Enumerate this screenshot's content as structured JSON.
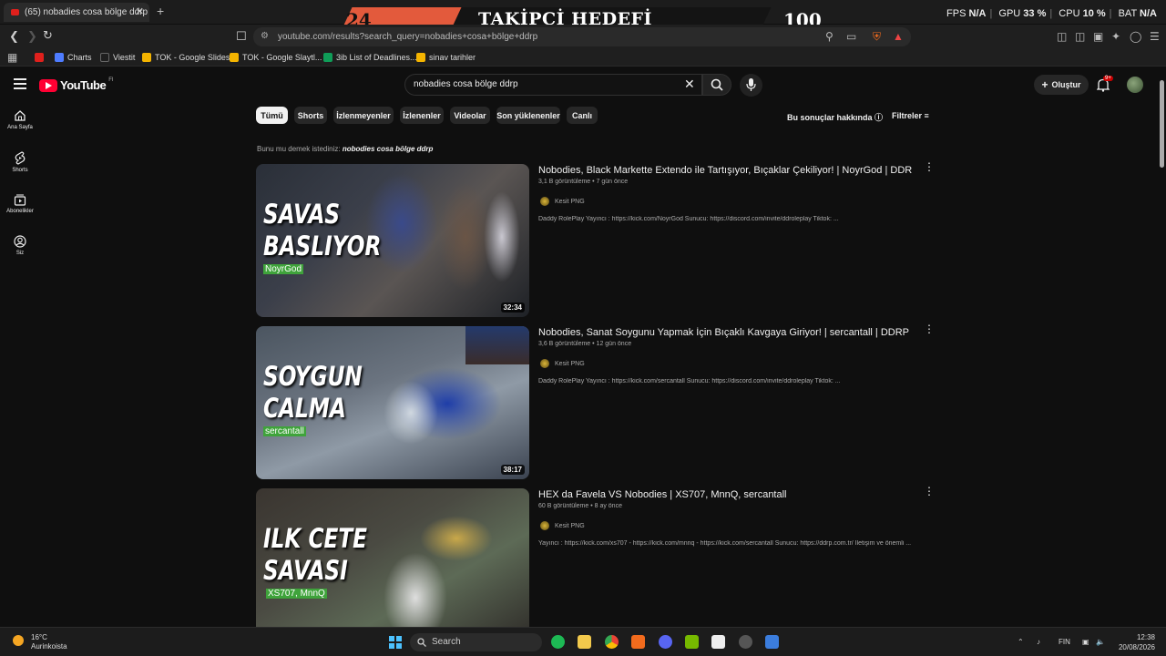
{
  "browser": {
    "tab_title": "(65) nobadies cosa bölge ddrp -",
    "tab_close": "✕",
    "new_tab": "+",
    "url": "youtube.com/results?search_query=nobadies+cosa+bölge+ddrp",
    "bookmarks": [
      {
        "label": "",
        "color": "#e0201c"
      },
      {
        "label": "Charts",
        "color": "#4e7cff"
      },
      {
        "label": "Viestit",
        "color": "#555555"
      },
      {
        "label": "TOK - Google Slides",
        "color": "#f4b400"
      },
      {
        "label": "TOK - Google Slaytl...",
        "color": "#f4b400"
      },
      {
        "label": "3ib List of Deadlines...",
        "color": "#0f9d58"
      },
      {
        "label": "sinav tarihler",
        "color": "#f4b400"
      }
    ]
  },
  "overlay": {
    "left_number": "24",
    "title": "TAKİPÇİ HEDEFİ",
    "right_number": "100"
  },
  "system_stats": {
    "fps_label": "FPS",
    "fps_value": "N/A",
    "gpu_label": "GPU",
    "gpu_value": "33 %",
    "cpu_label": "CPU",
    "cpu_value": "10 %",
    "bat_label": "BAT",
    "bat_value": "N/A"
  },
  "youtube": {
    "logo_text": "YouTube",
    "logo_country": "FI",
    "search_query": "nobadies cosa bölge ddrp",
    "create_label": "Oluştur",
    "notification_count": "9+",
    "sidebar": [
      {
        "label": "Ana Sayfa",
        "icon": "home-icon"
      },
      {
        "label": "Shorts",
        "icon": "shorts-icon"
      },
      {
        "label": "Abonelikler",
        "icon": "subscriptions-icon"
      },
      {
        "label": "Siz",
        "icon": "you-icon"
      }
    ],
    "chips": [
      "Tümü",
      "Shorts",
      "İzlenmeyenler",
      "İzlenenler",
      "Videolar",
      "Son yüklenenler",
      "Canlı"
    ],
    "about_results": "Bu sonuçlar hakkında",
    "filters": "Filtreler",
    "did_you_mean_prefix": "Bunu mu demek istediniz:",
    "did_you_mean_query": "nobodies cosa bölge ddrp",
    "results": [
      {
        "title": "Nobodies, Black Markette Extendo ile Tartışıyor, Bıçaklar Çekiliyor! | NoyrGod | DDRP",
        "views": "3,1 B görüntüleme",
        "age": "7 gün önce",
        "channel": "Kesit PNG",
        "description": "Daddy RolePlay Yayıncı : https://kick.com/NoyrGod Sunucu: https://discord.com/invite/ddroleplay Tiktok: ...",
        "duration": "32:34",
        "thumb_line1": "SAVAS",
        "thumb_line2": "BASLIYOR",
        "thumb_tag": "NoyrGod"
      },
      {
        "title": "Nobodies, Sanat Soygunu Yapmak İçin Bıçaklı Kavgaya Giriyor! | sercantall | DDRP",
        "views": "3,6 B görüntüleme",
        "age": "12 gün önce",
        "channel": "Kesit PNG",
        "description": "Daddy RolePlay Yayıncı : https://kick.com/sercantall Sunucu: https://discord.com/invite/ddroleplay Tiktok: ...",
        "duration": "38:17",
        "thumb_line1": "SOYGUN",
        "thumb_line2": "CALMA",
        "thumb_tag": "sercantall"
      },
      {
        "title": "HEX da Favela VS Nobodies | XS707, MnnQ, sercantall",
        "views": "60 B görüntüleme",
        "age": "8 ay önce",
        "channel": "Kesit PNG",
        "description": "Yayıncı : https://kick.com/xs707 - https://kick.com/mnnq - https://kick.com/sercantall Sunucu: https://ddrp.com.tr/ İletişim ve önemli ...",
        "duration": "",
        "thumb_line1": "ILK CETE",
        "thumb_line2": "SAVASI",
        "thumb_tag": "XS707, MnnQ"
      }
    ]
  },
  "taskbar": {
    "temperature": "16°C",
    "weather": "Aurinkoista",
    "search_label": "Search",
    "language": "FIN",
    "time": "12:38",
    "date": "20/08/2026"
  }
}
